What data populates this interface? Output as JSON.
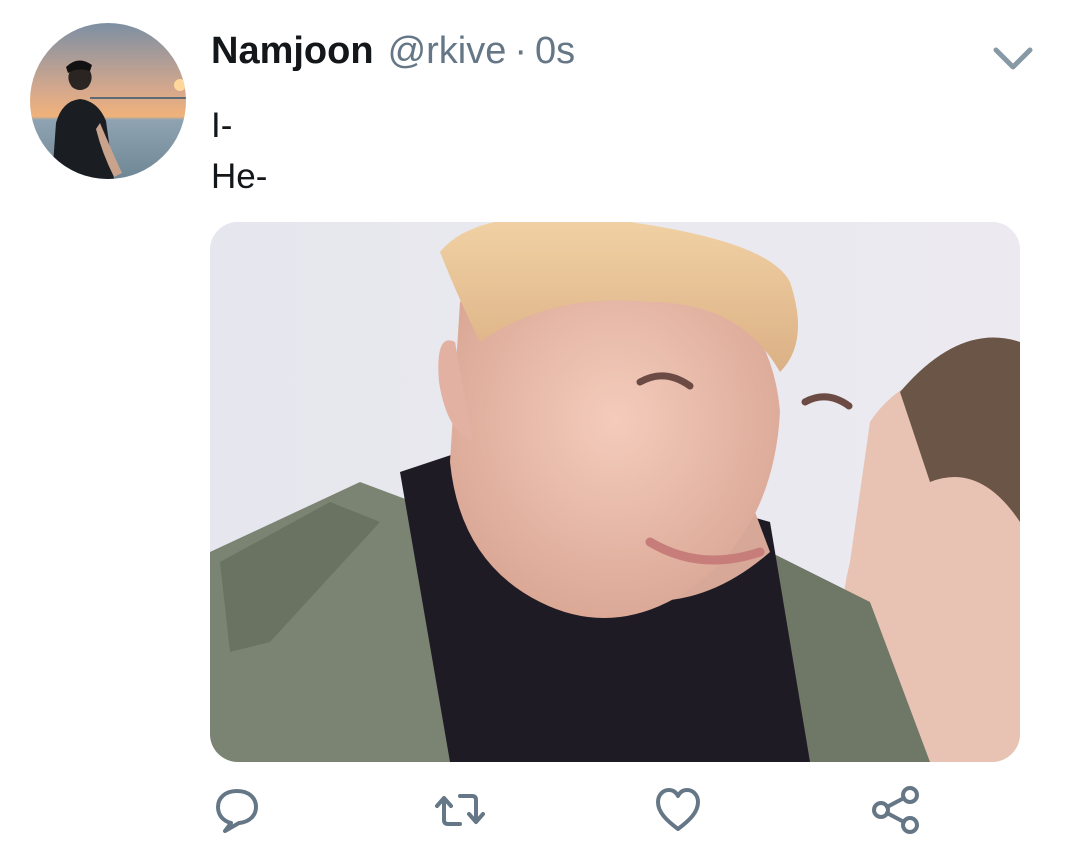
{
  "tweet": {
    "display_name": "Namjoon",
    "handle": "@rkive",
    "separator": "·",
    "time": "0s",
    "text_lines": [
      "I-",
      "He-"
    ]
  },
  "icons": {
    "caret": "chevron-down-icon",
    "reply": "reply-icon",
    "retweet": "retweet-icon",
    "like": "heart-icon",
    "share": "share-icon"
  },
  "colors": {
    "name": "#14171a",
    "secondary": "#657786",
    "icon": "#657786",
    "background": "#ffffff"
  }
}
